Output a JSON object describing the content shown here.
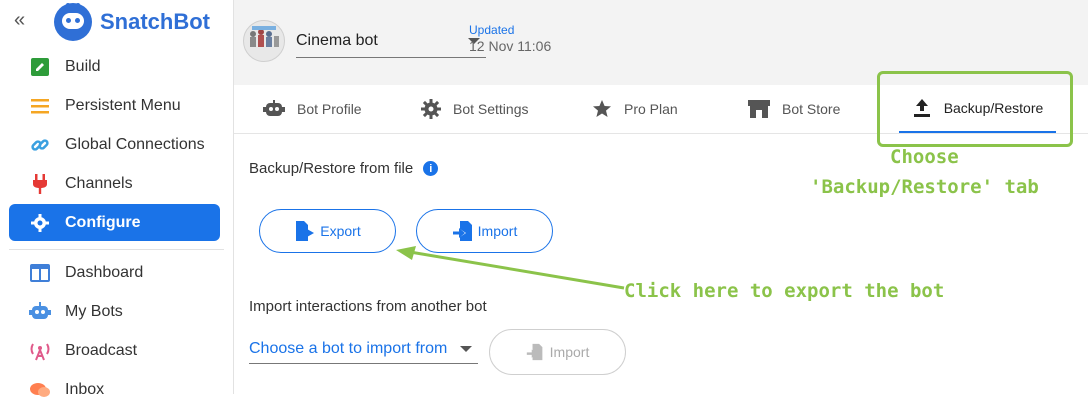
{
  "sidebar": {
    "collapse_glyph": "«",
    "brand_name": "SnatchBot",
    "items": [
      {
        "label": "Build",
        "icon": "edit-icon",
        "color": "#2e9c3a"
      },
      {
        "label": "Persistent Menu",
        "icon": "menu-icon",
        "color": "#f5a623"
      },
      {
        "label": "Global Connections",
        "icon": "link-icon",
        "color": "#3aa0e0"
      },
      {
        "label": "Channels",
        "icon": "plug-icon",
        "color": "#e53935"
      },
      {
        "label": "Configure",
        "icon": "gear-icon",
        "color": "#ffffff",
        "active": true
      },
      {
        "label": "Dashboard",
        "icon": "dashboard-icon",
        "color": "#3f7fd8"
      },
      {
        "label": "My Bots",
        "icon": "robot-icon",
        "color": "#4a90e2"
      },
      {
        "label": "Broadcast",
        "icon": "broadcast-icon",
        "color": "#e05a8a"
      },
      {
        "label": "Inbox",
        "icon": "chat-icon",
        "color": "#ff7f50"
      }
    ]
  },
  "topbar": {
    "bot_name": "Cinema bot",
    "updated_label": "Updated",
    "updated_date": "12 Nov 11:06"
  },
  "tabs": [
    {
      "label": "Bot Profile",
      "icon": "robot-icon"
    },
    {
      "label": "Bot Settings",
      "icon": "gear-icon"
    },
    {
      "label": "Pro Plan",
      "icon": "star-icon"
    },
    {
      "label": "Bot Store",
      "icon": "store-icon"
    },
    {
      "label": "Backup/Restore",
      "icon": "upload-icon",
      "active": true
    }
  ],
  "content": {
    "backup_title": "Backup/Restore from file",
    "info_glyph": "i",
    "export_label": "Export",
    "import_label": "Import",
    "import_interactions_title": "Import interactions from another bot",
    "choose_bot_placeholder": "Choose a bot to import from",
    "import_disabled_label": "Import"
  },
  "annotations": {
    "choose_line1": "Choose",
    "choose_line2": "'Backup/Restore' tab",
    "export_hint": "Click here to export the bot",
    "color": "#8bc34a"
  },
  "colors": {
    "accent": "#1a73e8",
    "topbar_bg": "#f3f3f3"
  }
}
